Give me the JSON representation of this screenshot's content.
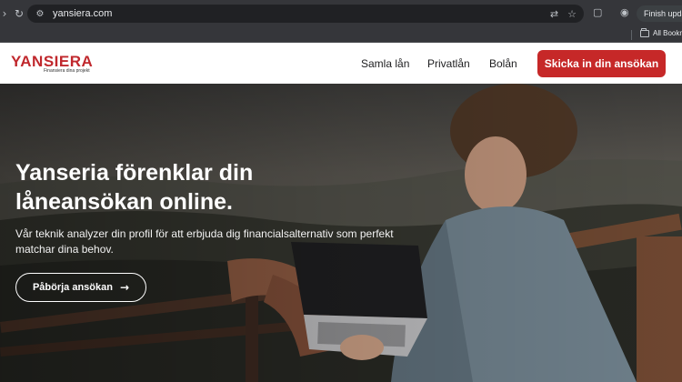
{
  "browser": {
    "url": "yansiera.com",
    "finish_button": "Finish update",
    "bookmarks_folder": "All Bookm",
    "icons": [
      "forward-icon",
      "reload-icon",
      "site-info-icon",
      "translate-icon",
      "star-icon",
      "reading-list-icon",
      "profile-icon",
      "folder-icon"
    ]
  },
  "header": {
    "logo": "YANSIERA",
    "tagline": "Finansiera dina projekt",
    "nav": [
      "Samla lån",
      "Privatlån",
      "Bolån"
    ],
    "cta": "Skicka in din ansökan"
  },
  "hero": {
    "title": "Yanseria förenklar din låneansökan online.",
    "subtitle": "Vår teknik analyzer din profil för att erbjuda dig financialsalternativ som perfekt matchar dina behov.",
    "button": "Påbörja ansökan",
    "button_icon": "arrow-right-icon"
  },
  "colors": {
    "brand_red": "#c62828",
    "chrome_dark": "#35363a",
    "header_bg": "#ffffff"
  }
}
